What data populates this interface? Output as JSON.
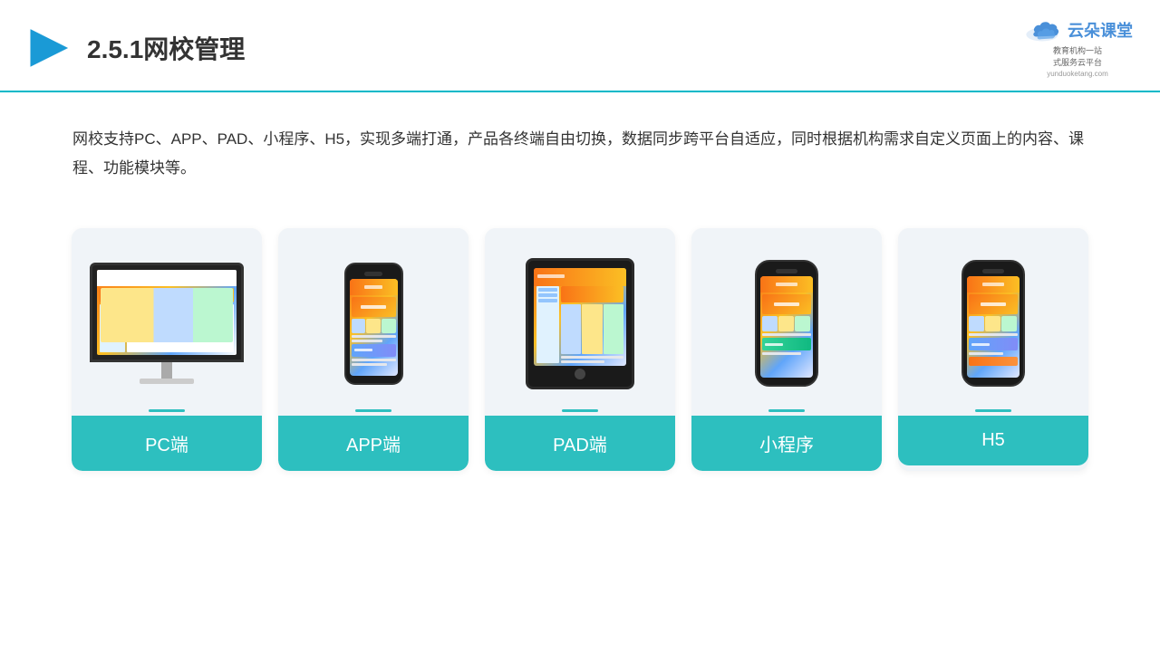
{
  "header": {
    "title": "2.5.1网校管理",
    "title_number": "2.5.1",
    "title_main": "网校管理"
  },
  "logo": {
    "brand": "云朵课堂",
    "url": "yunduoketang.com",
    "tagline1": "教育机构一站",
    "tagline2": "式服务云平台"
  },
  "description": {
    "text": "网校支持PC、APP、PAD、小程序、H5，实现多端打通，产品各终端自由切换，数据同步跨平台自适应，同时根据机构需求自定义页面上的内容、课程、功能模块等。"
  },
  "cards": [
    {
      "id": "pc",
      "label": "PC端"
    },
    {
      "id": "app",
      "label": "APP端"
    },
    {
      "id": "pad",
      "label": "PAD端"
    },
    {
      "id": "miniapp",
      "label": "小程序"
    },
    {
      "id": "h5",
      "label": "H5"
    }
  ]
}
